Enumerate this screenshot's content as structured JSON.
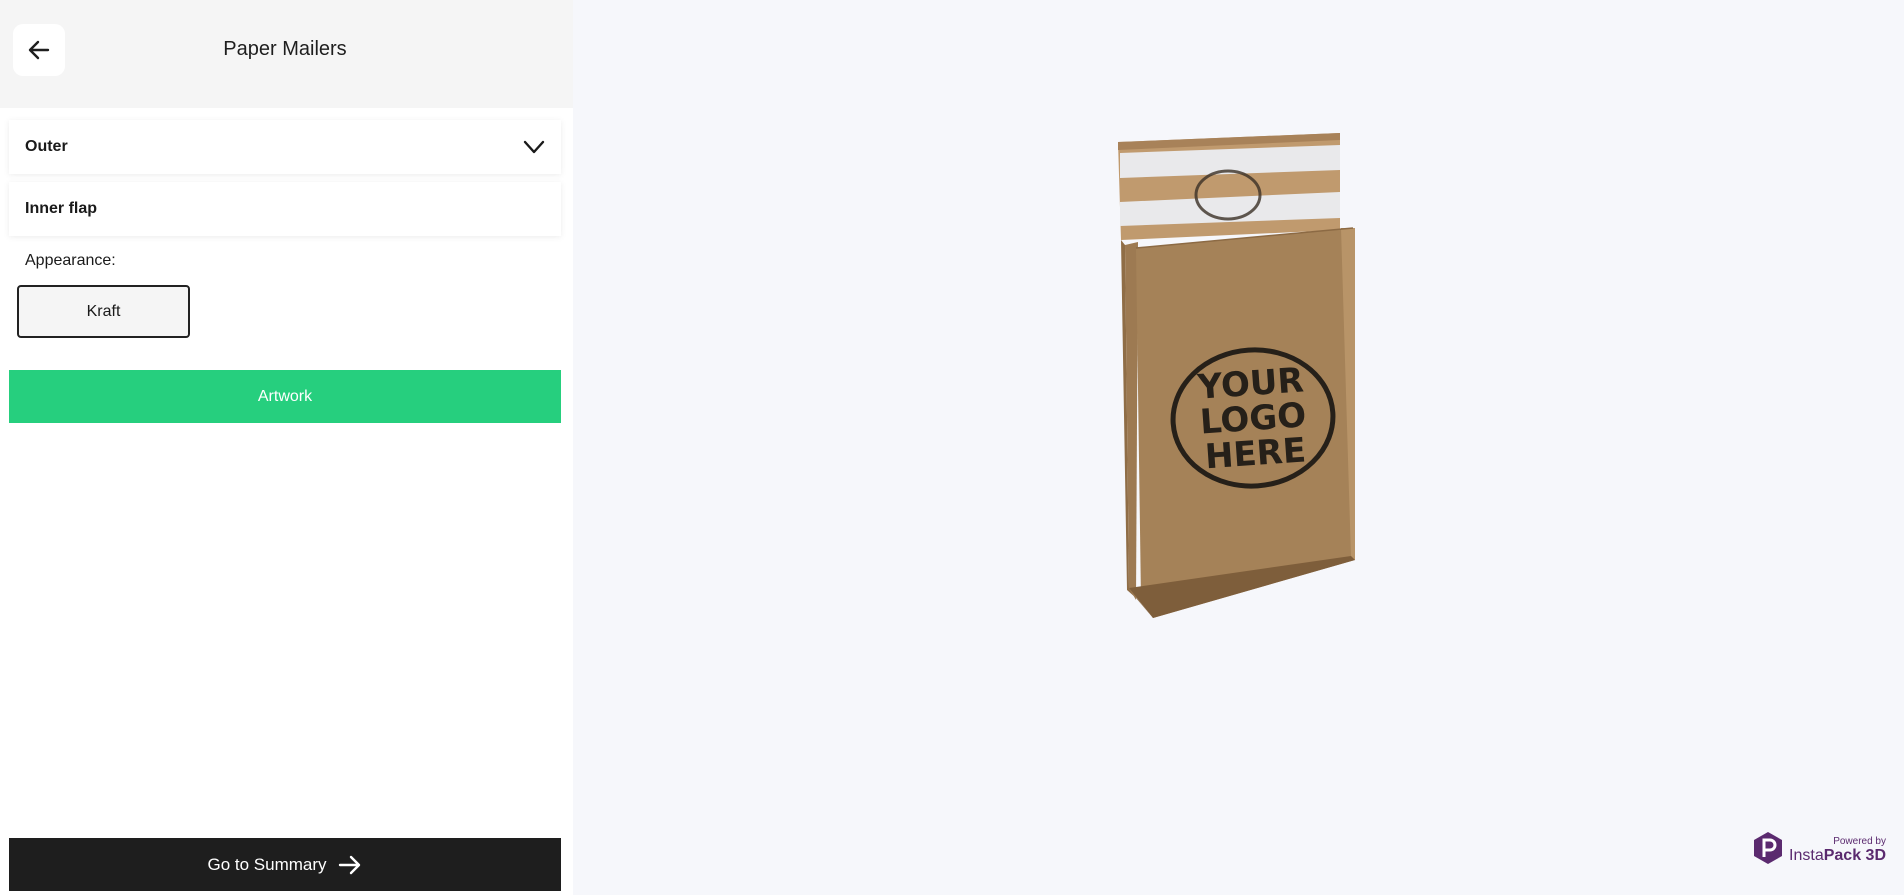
{
  "header": {
    "title": "Paper Mailers",
    "back_icon": "arrow-left-icon"
  },
  "sections": {
    "outer_label": "Outer",
    "inner_flap_label": "Inner flap"
  },
  "appearance": {
    "label": "Appearance:",
    "selected_option": "Kraft"
  },
  "buttons": {
    "artwork": "Artwork",
    "summary": "Go to Summary"
  },
  "viewer": {
    "logo_lines": [
      "YOUR",
      "LOGO",
      "HERE"
    ],
    "powered_by": "Powered by",
    "brand_light": "Insta",
    "brand_bold": "Pack 3D"
  },
  "colors": {
    "accent_green": "#26cf7e",
    "dark_button": "#1e1e1e",
    "kraft": "#b08a5f",
    "brand_purple": "#5b2a6f"
  }
}
